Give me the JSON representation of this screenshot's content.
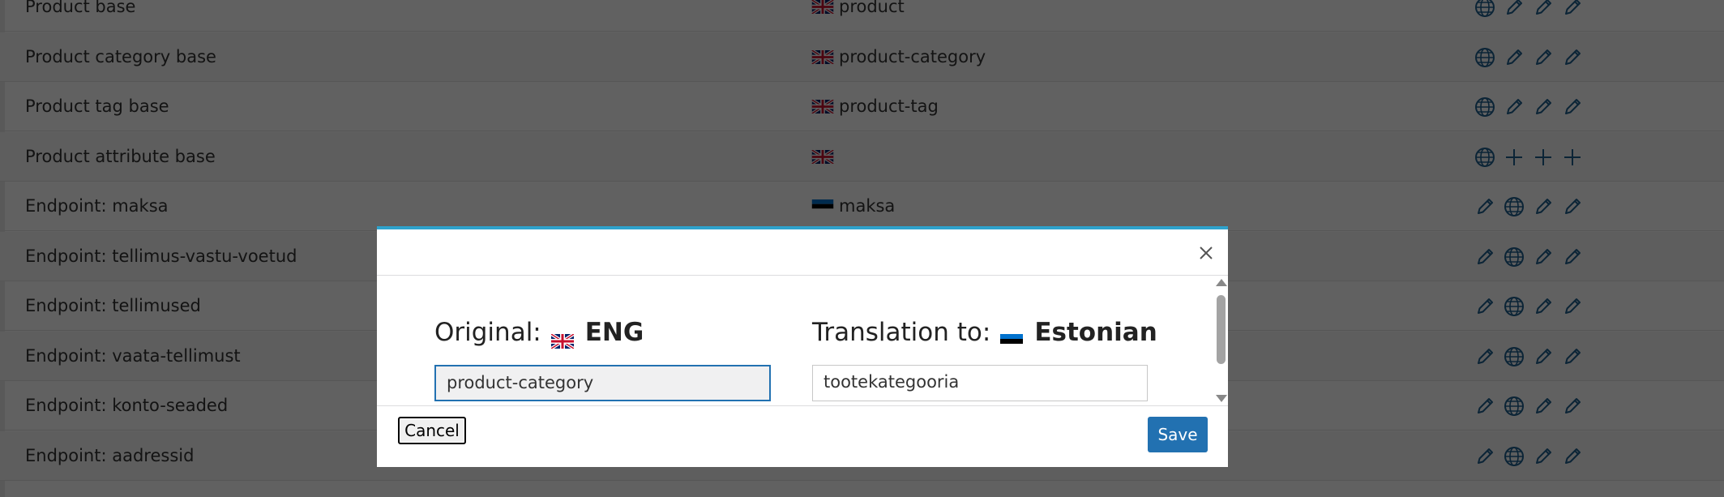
{
  "rows": [
    {
      "name": "Product base",
      "flag": "uk",
      "value": "product",
      "actions": [
        "globe-icon",
        "pencil-icon",
        "pencil-icon",
        "pencil-icon"
      ]
    },
    {
      "name": "Product category base",
      "flag": "uk",
      "value": "product-category",
      "actions": [
        "globe-icon",
        "pencil-icon",
        "pencil-icon",
        "pencil-icon"
      ]
    },
    {
      "name": "Product tag base",
      "flag": "uk",
      "value": "product-tag",
      "actions": [
        "globe-icon",
        "pencil-icon",
        "pencil-icon",
        "pencil-icon"
      ]
    },
    {
      "name": "Product attribute base",
      "flag": "uk",
      "value": "",
      "actions": [
        "globe-icon",
        "plus-icon",
        "plus-icon",
        "plus-icon"
      ]
    },
    {
      "name": "Endpoint: maksa",
      "flag": "ee",
      "value": "maksa",
      "actions": [
        "pencil-icon",
        "globe-icon",
        "pencil-icon",
        "pencil-icon"
      ]
    },
    {
      "name": "Endpoint: tellimus-vastu-voetud",
      "flag": "",
      "value": "",
      "actions": [
        "pencil-icon",
        "globe-icon",
        "pencil-icon",
        "pencil-icon"
      ]
    },
    {
      "name": "Endpoint: tellimused",
      "flag": "",
      "value": "",
      "actions": [
        "pencil-icon",
        "globe-icon",
        "pencil-icon",
        "pencil-icon"
      ]
    },
    {
      "name": "Endpoint: vaata-tellimust",
      "flag": "",
      "value": "",
      "actions": [
        "pencil-icon",
        "globe-icon",
        "pencil-icon",
        "pencil-icon"
      ]
    },
    {
      "name": "Endpoint: konto-seaded",
      "flag": "",
      "value": "",
      "actions": [
        "pencil-icon",
        "globe-icon",
        "pencil-icon",
        "pencil-icon"
      ]
    },
    {
      "name": "Endpoint: aadressid",
      "flag": "",
      "value": "",
      "actions": [
        "pencil-icon",
        "globe-icon",
        "pencil-icon",
        "pencil-icon"
      ]
    }
  ],
  "modal": {
    "original_label": "Original:",
    "original_lang": "ENG",
    "original_flag": "uk",
    "translation_label": "Translation to:",
    "translation_lang": "Estonian",
    "translation_flag": "ee",
    "original_value": "product-category",
    "translation_value": "tootekategooria",
    "cancel_label": "Cancel",
    "save_label": "Save"
  },
  "colors": {
    "accent": "#2271b1",
    "modal_top_border": "#2ea2cc",
    "icon": "#1d5f8f"
  }
}
